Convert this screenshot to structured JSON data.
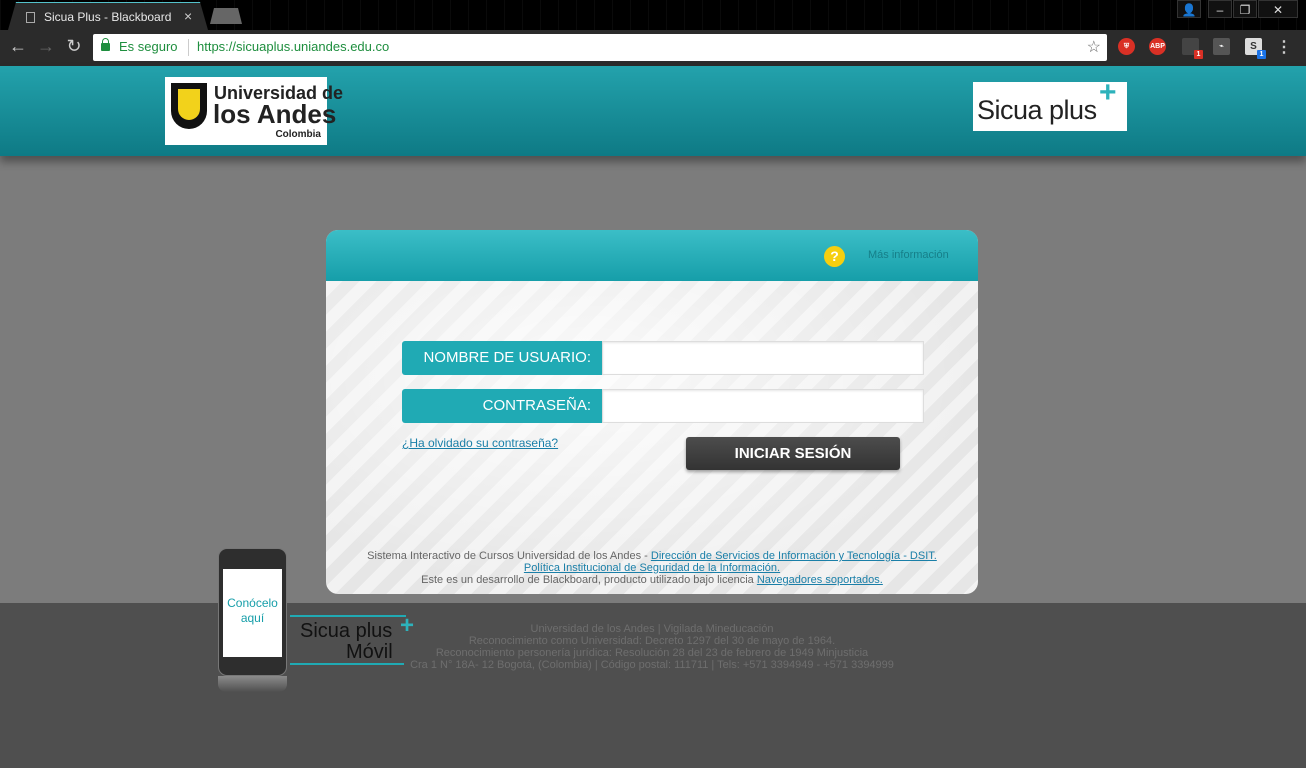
{
  "browser": {
    "tab_title": "Sicua Plus - Blackboard",
    "secure_label": "Es seguro",
    "url": "https://sicuaplus.uniandes.edu.co",
    "extensions": [
      {
        "name": "ublock-icon",
        "color": "#d93025",
        "label": ""
      },
      {
        "name": "adblock-plus-icon",
        "color": "#d93025",
        "label": "ABP",
        "badge": ""
      },
      {
        "name": "extension-icon",
        "color": "#555555",
        "label": "",
        "badge": "1"
      },
      {
        "name": "pdf-icon",
        "color": "#666666",
        "label": "",
        "badge": ""
      },
      {
        "name": "skype-icon",
        "color": "#dddddd",
        "label": "S",
        "badge": "1"
      }
    ]
  },
  "header": {
    "uandes_logo": {
      "line1": "Universidad de",
      "line2": "los Andes",
      "line3": "Colombia"
    },
    "sicua_logo": {
      "text": "Sicua plus",
      "plus": "+"
    }
  },
  "login": {
    "help_icon": "?",
    "more_info": "Más información",
    "username_label": "NOMBRE DE USUARIO:",
    "username_value": "",
    "password_label": "CONTRASEÑA:",
    "password_value": "",
    "forgot_link": "¿Ha olvidado su contraseña?",
    "submit_label": "INICIAR SESIÓN",
    "footer": {
      "line1_text": "Sistema Interactivo de Cursos Universidad de los Andes - ",
      "line1_link": "Dirección de Servicios de Información y Tecnología - DSIT.",
      "line2_link": "Política Institucional de Seguridad de la Información.",
      "line3_text": "Este es un desarrollo de Blackboard, producto utilizado bajo licencia ",
      "line3_link": "Navegadores soportados."
    }
  },
  "promo": {
    "phone_text_1": "Conócelo",
    "phone_text_2": "aquí",
    "title_1": "Sicua plus",
    "title_2": "Móvil",
    "plus": "+"
  },
  "footer": {
    "line1": "Universidad de los Andes | Vigilada Mineducación",
    "line2": "Reconocimiento como Universidad: Decreto 1297 del 30 de mayo de 1964.",
    "line3": "Reconocimiento personería jurídica: Resolución 28 del 23 de febrero de 1949 Minjusticia",
    "line4": "Cra 1 N° 18A- 12 Bogotá, (Colombia) | Código postal: 111711 | Tels: +571 3394949 - +571 3394999"
  }
}
